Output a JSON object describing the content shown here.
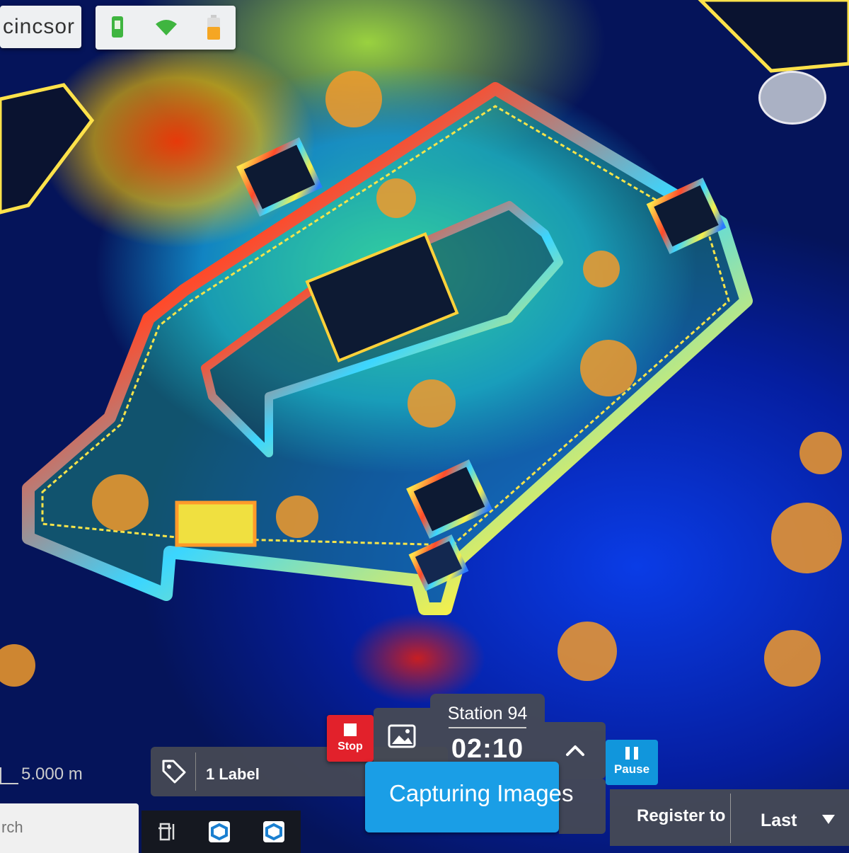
{
  "header": {
    "device_name": "cincsor",
    "status_icons": [
      "device-icon",
      "wifi-icon",
      "battery-icon"
    ]
  },
  "map": {
    "scale_label": "5.000 m",
    "view_mode": "point-cloud"
  },
  "label_bar": {
    "icon": "tag-icon",
    "label_text": "1 Label"
  },
  "capture_controls": {
    "stop_label": "Stop",
    "image_icon": "image-icon",
    "station_name": "Station 94",
    "timer": "02:10",
    "expand_icon": "chevron-up-icon",
    "pause_label": "Pause",
    "status_text": "Capturing Images"
  },
  "register": {
    "label": "Register to",
    "value": "Last"
  },
  "search": {
    "placeholder": "rch"
  },
  "taskbar": {
    "icons": [
      "panel-icon",
      "app-icon",
      "app-icon"
    ]
  },
  "colors": {
    "stop": "#e2212b",
    "accent": "#1a9ee6",
    "panel_dark": "#464a54"
  }
}
